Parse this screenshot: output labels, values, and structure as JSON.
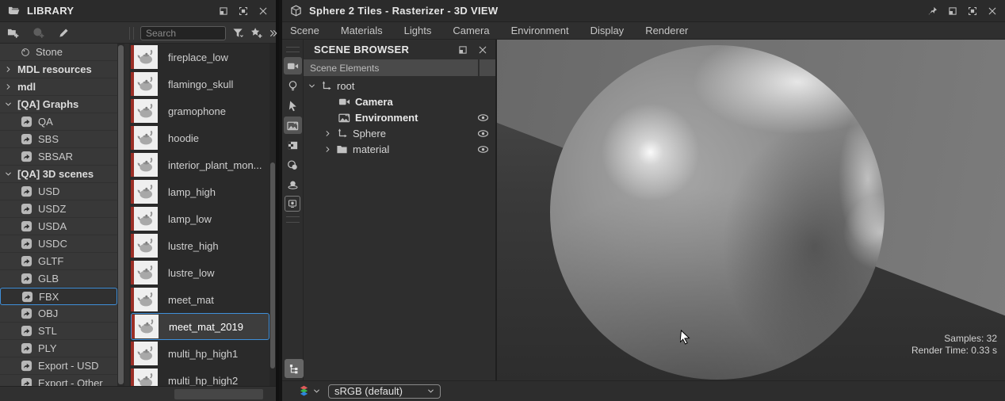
{
  "library": {
    "title": "LIBRARY",
    "search_placeholder": "Search",
    "sidebar": {
      "items": [
        {
          "label": "Stone"
        },
        {
          "label": "MDL resources"
        },
        {
          "label": "mdl"
        },
        {
          "label": "[QA] Graphs"
        },
        {
          "label": "QA"
        },
        {
          "label": "SBS"
        },
        {
          "label": "SBSAR"
        },
        {
          "label": "[QA] 3D scenes"
        },
        {
          "label": "USD"
        },
        {
          "label": "USDZ"
        },
        {
          "label": "USDA"
        },
        {
          "label": "USDC"
        },
        {
          "label": "GLTF"
        },
        {
          "label": "GLB"
        },
        {
          "label": "FBX",
          "selected": true
        },
        {
          "label": "OBJ"
        },
        {
          "label": "STL"
        },
        {
          "label": "PLY"
        },
        {
          "label": "Export - USD"
        },
        {
          "label": "Export - Other"
        }
      ]
    },
    "assets": {
      "items": [
        {
          "label": "fireplace_low"
        },
        {
          "label": "flamingo_skull"
        },
        {
          "label": "gramophone"
        },
        {
          "label": "hoodie"
        },
        {
          "label": "interior_plant_mon..."
        },
        {
          "label": "lamp_high"
        },
        {
          "label": "lamp_low"
        },
        {
          "label": "lustre_high"
        },
        {
          "label": "lustre_low"
        },
        {
          "label": "meet_mat"
        },
        {
          "label": "meet_mat_2019",
          "selected": true
        },
        {
          "label": "multi_hp_high1"
        },
        {
          "label": "multi_hp_high2"
        }
      ]
    }
  },
  "viewer": {
    "title": "Sphere 2 Tiles - Rasterizer - 3D VIEW",
    "menu": {
      "items": [
        "Scene",
        "Materials",
        "Lights",
        "Camera",
        "Environment",
        "Display",
        "Renderer"
      ]
    },
    "scene_browser": {
      "title": "SCENE BROWSER",
      "column_header": "Scene Elements",
      "tree": {
        "items": [
          {
            "label": "root",
            "icon": "transform",
            "expanded": true
          },
          {
            "label": "Camera",
            "icon": "camera",
            "bold": true
          },
          {
            "label": "Environment",
            "icon": "environment",
            "bold": true,
            "eye": true
          },
          {
            "label": "Sphere",
            "icon": "transform",
            "collapsed": true,
            "eye": true
          },
          {
            "label": "material",
            "icon": "folder",
            "collapsed": true,
            "eye": true
          }
        ]
      }
    },
    "viewport": {
      "samples": "Samples: 32",
      "render_time": "Render Time: 0.33 s"
    },
    "colorspace": {
      "value": "sRGB (default)"
    }
  },
  "colors": {
    "accent": "#3f8fd9",
    "thumbnail_stripe": "#9c2f26",
    "layers_red": "#e05a5a",
    "layers_green": "#39b54a",
    "layers_blue": "#2e86de"
  }
}
